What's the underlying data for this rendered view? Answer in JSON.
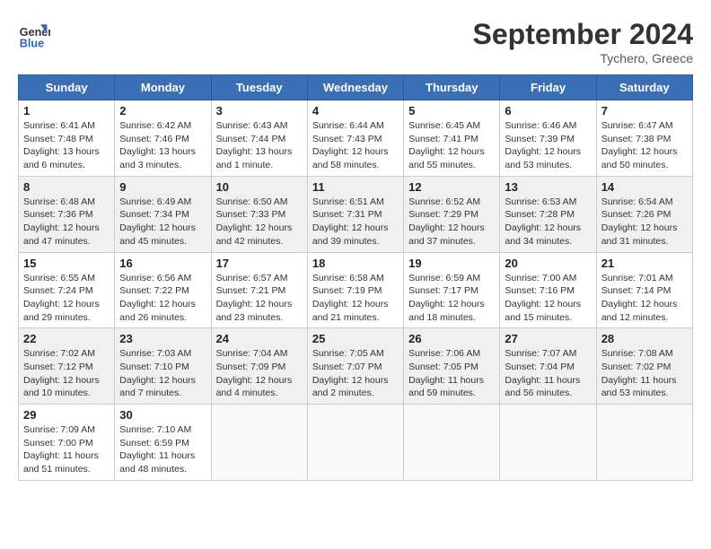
{
  "header": {
    "logo_line1": "General",
    "logo_line2": "Blue",
    "month_title": "September 2024",
    "location": "Tychero, Greece"
  },
  "days_of_week": [
    "Sunday",
    "Monday",
    "Tuesday",
    "Wednesday",
    "Thursday",
    "Friday",
    "Saturday"
  ],
  "weeks": [
    [
      {
        "day": "1",
        "sunrise": "6:41 AM",
        "sunset": "7:48 PM",
        "daylight": "13 hours and 6 minutes."
      },
      {
        "day": "2",
        "sunrise": "6:42 AM",
        "sunset": "7:46 PM",
        "daylight": "13 hours and 3 minutes."
      },
      {
        "day": "3",
        "sunrise": "6:43 AM",
        "sunset": "7:44 PM",
        "daylight": "13 hours and 1 minute."
      },
      {
        "day": "4",
        "sunrise": "6:44 AM",
        "sunset": "7:43 PM",
        "daylight": "12 hours and 58 minutes."
      },
      {
        "day": "5",
        "sunrise": "6:45 AM",
        "sunset": "7:41 PM",
        "daylight": "12 hours and 55 minutes."
      },
      {
        "day": "6",
        "sunrise": "6:46 AM",
        "sunset": "7:39 PM",
        "daylight": "12 hours and 53 minutes."
      },
      {
        "day": "7",
        "sunrise": "6:47 AM",
        "sunset": "7:38 PM",
        "daylight": "12 hours and 50 minutes."
      }
    ],
    [
      {
        "day": "8",
        "sunrise": "6:48 AM",
        "sunset": "7:36 PM",
        "daylight": "12 hours and 47 minutes."
      },
      {
        "day": "9",
        "sunrise": "6:49 AM",
        "sunset": "7:34 PM",
        "daylight": "12 hours and 45 minutes."
      },
      {
        "day": "10",
        "sunrise": "6:50 AM",
        "sunset": "7:33 PM",
        "daylight": "12 hours and 42 minutes."
      },
      {
        "day": "11",
        "sunrise": "6:51 AM",
        "sunset": "7:31 PM",
        "daylight": "12 hours and 39 minutes."
      },
      {
        "day": "12",
        "sunrise": "6:52 AM",
        "sunset": "7:29 PM",
        "daylight": "12 hours and 37 minutes."
      },
      {
        "day": "13",
        "sunrise": "6:53 AM",
        "sunset": "7:28 PM",
        "daylight": "12 hours and 34 minutes."
      },
      {
        "day": "14",
        "sunrise": "6:54 AM",
        "sunset": "7:26 PM",
        "daylight": "12 hours and 31 minutes."
      }
    ],
    [
      {
        "day": "15",
        "sunrise": "6:55 AM",
        "sunset": "7:24 PM",
        "daylight": "12 hours and 29 minutes."
      },
      {
        "day": "16",
        "sunrise": "6:56 AM",
        "sunset": "7:22 PM",
        "daylight": "12 hours and 26 minutes."
      },
      {
        "day": "17",
        "sunrise": "6:57 AM",
        "sunset": "7:21 PM",
        "daylight": "12 hours and 23 minutes."
      },
      {
        "day": "18",
        "sunrise": "6:58 AM",
        "sunset": "7:19 PM",
        "daylight": "12 hours and 21 minutes."
      },
      {
        "day": "19",
        "sunrise": "6:59 AM",
        "sunset": "7:17 PM",
        "daylight": "12 hours and 18 minutes."
      },
      {
        "day": "20",
        "sunrise": "7:00 AM",
        "sunset": "7:16 PM",
        "daylight": "12 hours and 15 minutes."
      },
      {
        "day": "21",
        "sunrise": "7:01 AM",
        "sunset": "7:14 PM",
        "daylight": "12 hours and 12 minutes."
      }
    ],
    [
      {
        "day": "22",
        "sunrise": "7:02 AM",
        "sunset": "7:12 PM",
        "daylight": "12 hours and 10 minutes."
      },
      {
        "day": "23",
        "sunrise": "7:03 AM",
        "sunset": "7:10 PM",
        "daylight": "12 hours and 7 minutes."
      },
      {
        "day": "24",
        "sunrise": "7:04 AM",
        "sunset": "7:09 PM",
        "daylight": "12 hours and 4 minutes."
      },
      {
        "day": "25",
        "sunrise": "7:05 AM",
        "sunset": "7:07 PM",
        "daylight": "12 hours and 2 minutes."
      },
      {
        "day": "26",
        "sunrise": "7:06 AM",
        "sunset": "7:05 PM",
        "daylight": "11 hours and 59 minutes."
      },
      {
        "day": "27",
        "sunrise": "7:07 AM",
        "sunset": "7:04 PM",
        "daylight": "11 hours and 56 minutes."
      },
      {
        "day": "28",
        "sunrise": "7:08 AM",
        "sunset": "7:02 PM",
        "daylight": "11 hours and 53 minutes."
      }
    ],
    [
      {
        "day": "29",
        "sunrise": "7:09 AM",
        "sunset": "7:00 PM",
        "daylight": "11 hours and 51 minutes."
      },
      {
        "day": "30",
        "sunrise": "7:10 AM",
        "sunset": "6:59 PM",
        "daylight": "11 hours and 48 minutes."
      },
      null,
      null,
      null,
      null,
      null
    ]
  ]
}
